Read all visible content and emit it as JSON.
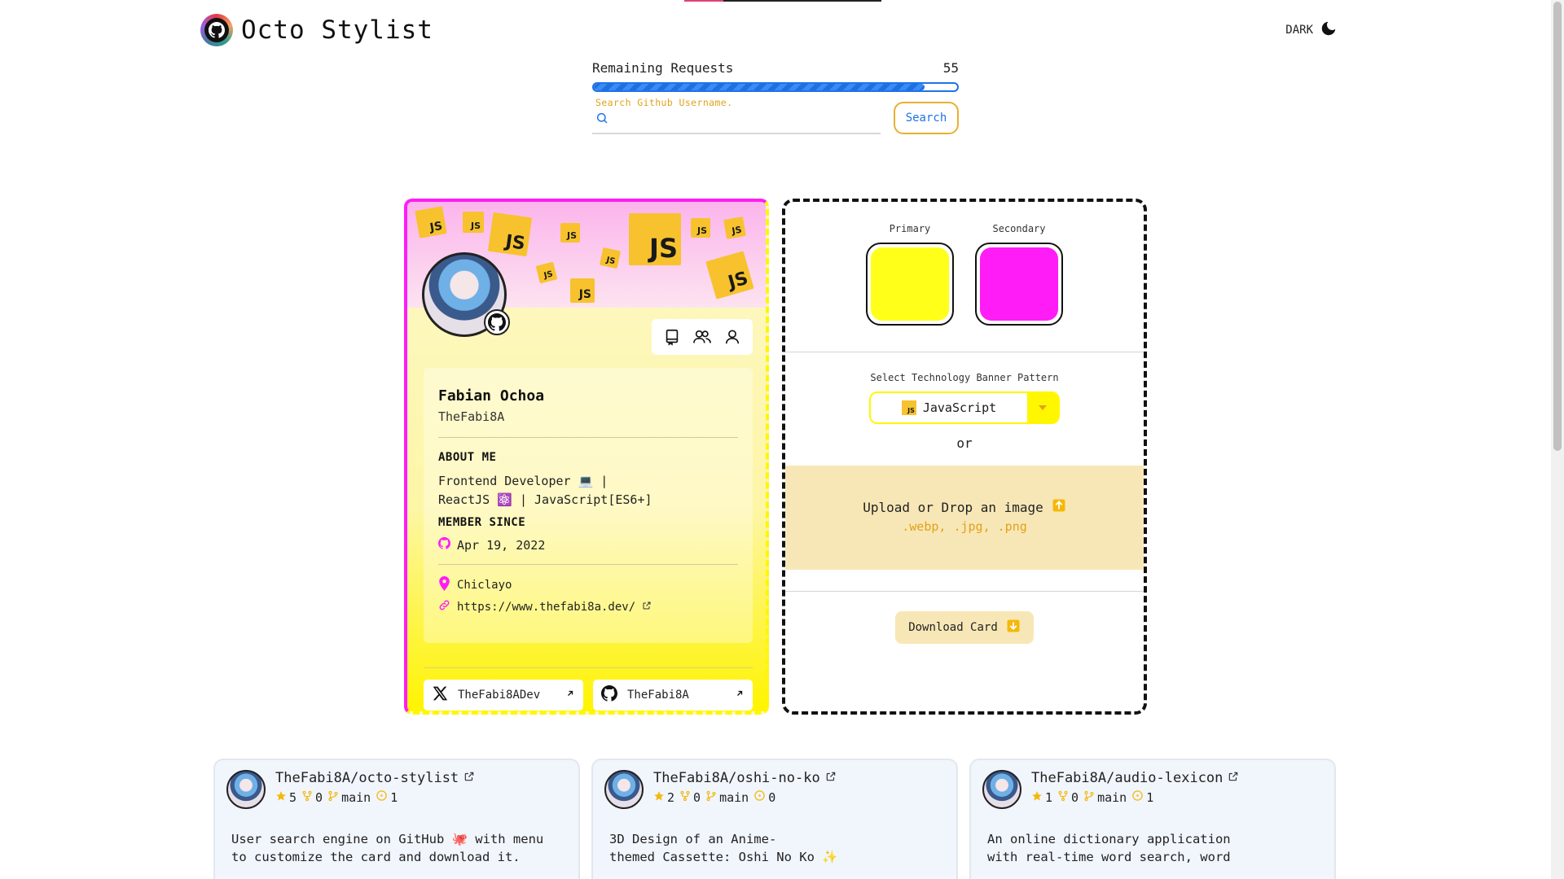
{
  "header": {
    "title": "Octo Stylist",
    "theme_label": "DARK"
  },
  "requests": {
    "label": "Remaining Requests",
    "count": "55",
    "progress_fraction": 0.91
  },
  "search": {
    "label": "Search Github Username.",
    "value": "",
    "button": "Search"
  },
  "profile": {
    "name": "Fabian Ochoa",
    "username": "TheFabi8A",
    "about_heading": "ABOUT ME",
    "about_line1": "Frontend Developer 💻 |",
    "about_line2": "ReactJS ⚛️ | JavaScript[ES6+]",
    "member_heading": "MEMBER SINCE",
    "member_date": "Apr 19, 2022",
    "location": "Chiclayo",
    "website": "https://www.thefabi8a.dev/",
    "banner_tile_text": "JS",
    "social_x": "TheFabi8ADev",
    "social_github": "TheFabi8A"
  },
  "customize": {
    "primary_label": "Primary",
    "secondary_label": "Secondary",
    "primary_color": "#ffff1a",
    "secondary_color": "#ff1cf6",
    "pattern_label": "Select Technology Banner Pattern",
    "pattern_value": "JavaScript",
    "pattern_icon_text": "JS",
    "or_text": "or",
    "upload_text": "Upload or Drop an image",
    "upload_ext": ".webp, .jpg, .png",
    "download_label": "Download Card"
  },
  "repos": [
    {
      "name": "TheFabi8A/octo-stylist",
      "stars": "5",
      "forks": "0",
      "branch": "main",
      "issues": "1",
      "desc_line1": "User search engine on GitHub 🐙 with menu",
      "desc_line2": "to customize the card and download it."
    },
    {
      "name": "TheFabi8A/oshi-no-ko",
      "stars": "2",
      "forks": "0",
      "branch": "main",
      "issues": "0",
      "desc_line1": "3D Design of an Anime-",
      "desc_line2": "themed Cassette: Oshi No Ko ✨"
    },
    {
      "name": "TheFabi8A/audio-lexicon",
      "stars": "1",
      "forks": "0",
      "branch": "main",
      "issues": "1",
      "desc_line1": "An online dictionary application",
      "desc_line2": "with real-time word search, word"
    }
  ],
  "colors": {
    "accent_blue": "#1e73e8",
    "accent_gold": "#e0a21a",
    "card_pink": "#ff1cf6",
    "card_yellow": "#fff700"
  }
}
